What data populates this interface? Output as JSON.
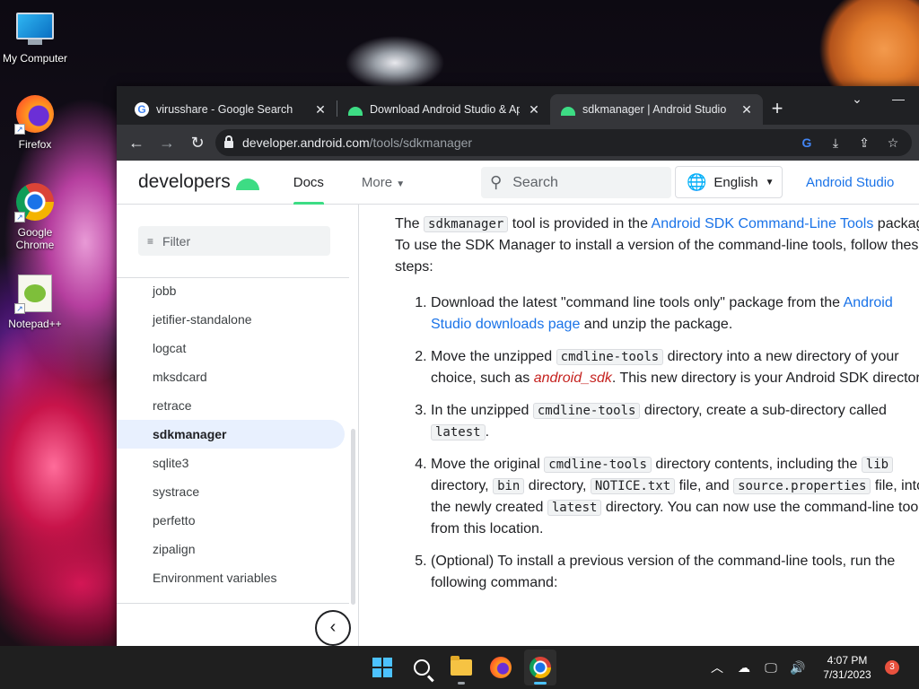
{
  "desktop": {
    "icons": [
      {
        "label": "My Computer",
        "icon": "computer-icon"
      },
      {
        "label": "Firefox",
        "icon": "firefox-icon"
      },
      {
        "label": "Google Chrome",
        "icon": "chrome-icon"
      },
      {
        "label": "Notepad++",
        "icon": "notepad-plus-plus-icon"
      }
    ]
  },
  "browser": {
    "tabs": [
      {
        "title": "virusshare - Google Search",
        "icon": "google-favicon",
        "close": "✕"
      },
      {
        "title": "Download Android Studio & App",
        "icon": "android-favicon",
        "close": "✕"
      },
      {
        "title": "sdkmanager | Android Studio",
        "icon": "android-favicon",
        "close": "✕",
        "active": true
      }
    ],
    "new_tab": "+",
    "window_controls": {
      "dropdown": "⌄",
      "minimize": "—"
    },
    "toolbar": {
      "back": "←",
      "forward": "→",
      "reload": "↻",
      "url_host": "developer.android.com",
      "url_path": "/tools/sdkmanager"
    }
  },
  "site": {
    "logo_text": "developers",
    "nav": {
      "docs": "Docs",
      "more": "More"
    },
    "search_placeholder": "Search",
    "language": "English",
    "studio_link": "Android Studio",
    "filter_placeholder": "Filter",
    "sidebar_items": [
      {
        "label": "jobb"
      },
      {
        "label": "jetifier-standalone"
      },
      {
        "label": "logcat"
      },
      {
        "label": "mksdcard"
      },
      {
        "label": "retrace"
      },
      {
        "label": "sdkmanager",
        "active": true
      },
      {
        "label": "sqlite3"
      },
      {
        "label": "systrace"
      },
      {
        "label": "perfetto"
      },
      {
        "label": "zipalign"
      },
      {
        "label": "Environment variables"
      }
    ],
    "collapse_glyph": "‹",
    "content": {
      "intro": {
        "t1": "The ",
        "c1": "sdkmanager",
        "t2": " tool is provided in the ",
        "link1": "Android SDK Command-Line Tools",
        "t3": " package. To use the SDK Manager to install a version of the command-line tools, follow these steps:"
      },
      "steps": {
        "s1": {
          "t1": "Download the latest \"command line tools only\" package from the ",
          "link": "Android Studio downloads page",
          "t2": " and unzip the package."
        },
        "s2": {
          "t1": "Move the unzipped ",
          "c1": "cmdline-tools",
          "t2": " directory into a new directory of your choice, such as ",
          "var": "android_sdk",
          "t3": ". This new directory is your Android SDK directory."
        },
        "s3": {
          "t1": "In the unzipped ",
          "c1": "cmdline-tools",
          "t2": " directory, create a sub-directory called ",
          "c2": "latest",
          "t3": "."
        },
        "s4": {
          "t1": "Move the original ",
          "c1": "cmdline-tools",
          "t2": " directory contents, including the ",
          "c2": "lib",
          "t3": " directory, ",
          "c3": "bin",
          "t4": " directory, ",
          "c4": "NOTICE.txt",
          "t5": " file, and ",
          "c5": "source.properties",
          "t6": " file, into the newly created ",
          "c6": "latest",
          "t7": " directory. You can now use the command-line tools from this location."
        },
        "s5": {
          "t1": "(Optional) To install a previous version of the command-line tools, run the following command:"
        }
      }
    }
  },
  "taskbar": {
    "apps": [
      "start-icon",
      "search-icon",
      "file-explorer-icon",
      "firefox-icon",
      "chrome-icon"
    ],
    "tray": {
      "chevron": "︿",
      "network": "🖵",
      "volume": "🔊"
    },
    "time": "4:07 PM",
    "date": "7/31/2023",
    "notification_count": "3"
  },
  "colors": {
    "accent_green": "#3ddc84",
    "link_blue": "#1a73e8",
    "chrome_dark": "#202124",
    "taskbar": "#1f1f1f"
  }
}
